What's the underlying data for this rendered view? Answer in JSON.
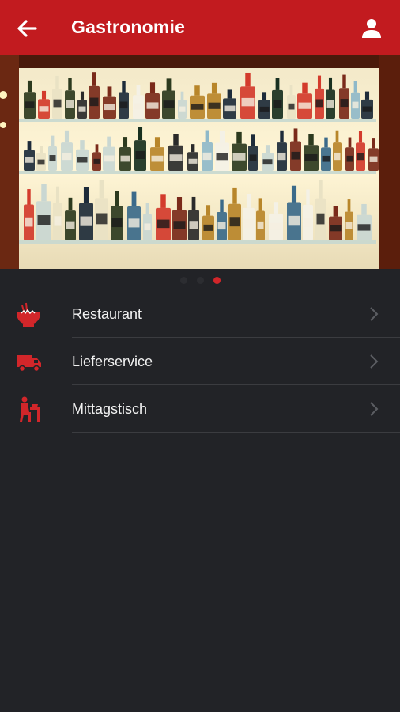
{
  "header": {
    "title": "Gastronomie",
    "back_icon": "arrow-left-icon",
    "profile_icon": "user-icon",
    "background_color": "#c21b1f"
  },
  "carousel": {
    "image": "bar shelves with liquor bottles",
    "page_count": 3,
    "active_index": 2,
    "active_color": "#d2262a"
  },
  "menu": {
    "items": [
      {
        "label": "Restaurant",
        "icon": "food-bowl-icon"
      },
      {
        "label": "Lieferservice",
        "icon": "delivery-truck-icon"
      },
      {
        "label": "Mittagstisch",
        "icon": "lunch-table-icon"
      }
    ],
    "chevron_icon": "chevron-right-icon"
  }
}
